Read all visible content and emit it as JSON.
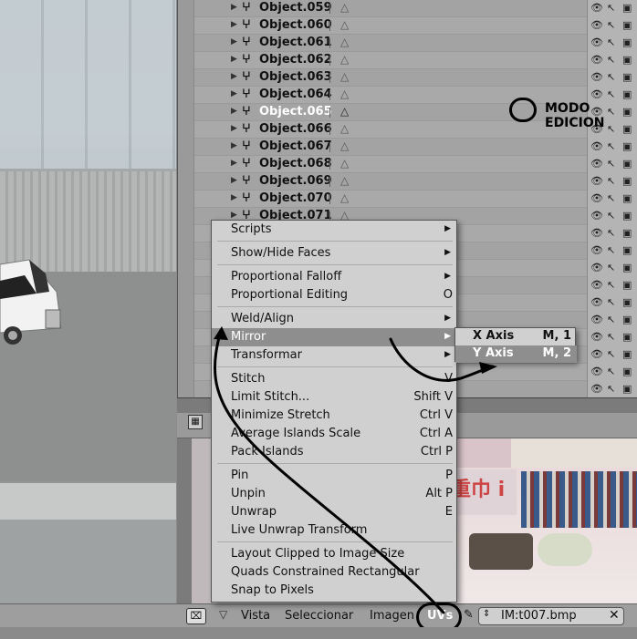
{
  "outliner": {
    "rows": [
      {
        "name": "Object.059"
      },
      {
        "name": "Object.060"
      },
      {
        "name": "Object.061"
      },
      {
        "name": "Object.062"
      },
      {
        "name": "Object.063"
      },
      {
        "name": "Object.064"
      },
      {
        "name": "Object.065",
        "selected": true
      },
      {
        "name": "Object.066"
      },
      {
        "name": "Object.067"
      },
      {
        "name": "Object.068"
      },
      {
        "name": "Object.069"
      },
      {
        "name": "Object.070"
      },
      {
        "name": "Object.071"
      }
    ],
    "annotation": "MODO EDICION"
  },
  "uvs_menu": {
    "items": [
      {
        "label": "Scripts",
        "submenu": true
      },
      {
        "label": "Show/Hide Faces",
        "submenu": true
      },
      {
        "label": "Proportional Falloff",
        "submenu": true
      },
      {
        "label": "Proportional Editing",
        "shortcut": "O"
      },
      {
        "label": "Weld/Align",
        "submenu": true
      },
      {
        "label": "Mirror",
        "submenu": true,
        "highlighted": true
      },
      {
        "label": "Transformar",
        "submenu": true
      },
      {
        "label": "Stitch",
        "shortcut": "V"
      },
      {
        "label": "Limit Stitch...",
        "shortcut": "Shift V"
      },
      {
        "label": "Minimize Stretch",
        "shortcut": "Ctrl V"
      },
      {
        "label": "Average Islands Scale",
        "shortcut": "Ctrl A"
      },
      {
        "label": "Pack Islands",
        "shortcut": "Ctrl P"
      },
      {
        "label": "Pin",
        "shortcut": "P"
      },
      {
        "label": "Unpin",
        "shortcut": "Alt P"
      },
      {
        "label": "Unwrap",
        "shortcut": "E"
      },
      {
        "label": "Live Unwrap Transform"
      },
      {
        "label": "Layout Clipped to Image Size"
      },
      {
        "label": "Quads Constrained Rectangular"
      },
      {
        "label": "Snap to Pixels"
      }
    ]
  },
  "mirror_submenu": {
    "items": [
      {
        "label": "X Axis",
        "shortcut": "M, 1"
      },
      {
        "label": "Y Axis",
        "shortcut": "M, 2",
        "highlighted": true
      }
    ]
  },
  "header": {
    "vista": "Vista",
    "seleccionar": "Seleccionar",
    "imagen": "Imagen",
    "uvs": "UVs",
    "image_name": "IM:t007.bmp"
  },
  "texture": {
    "kanji": "重巾 i"
  },
  "colors": {
    "menu_bg": "#d0d0d0",
    "menu_highlight": "#8e8e8e",
    "outliner_bg": "#a6a6a6",
    "header_bg": "#9e9e9e"
  }
}
